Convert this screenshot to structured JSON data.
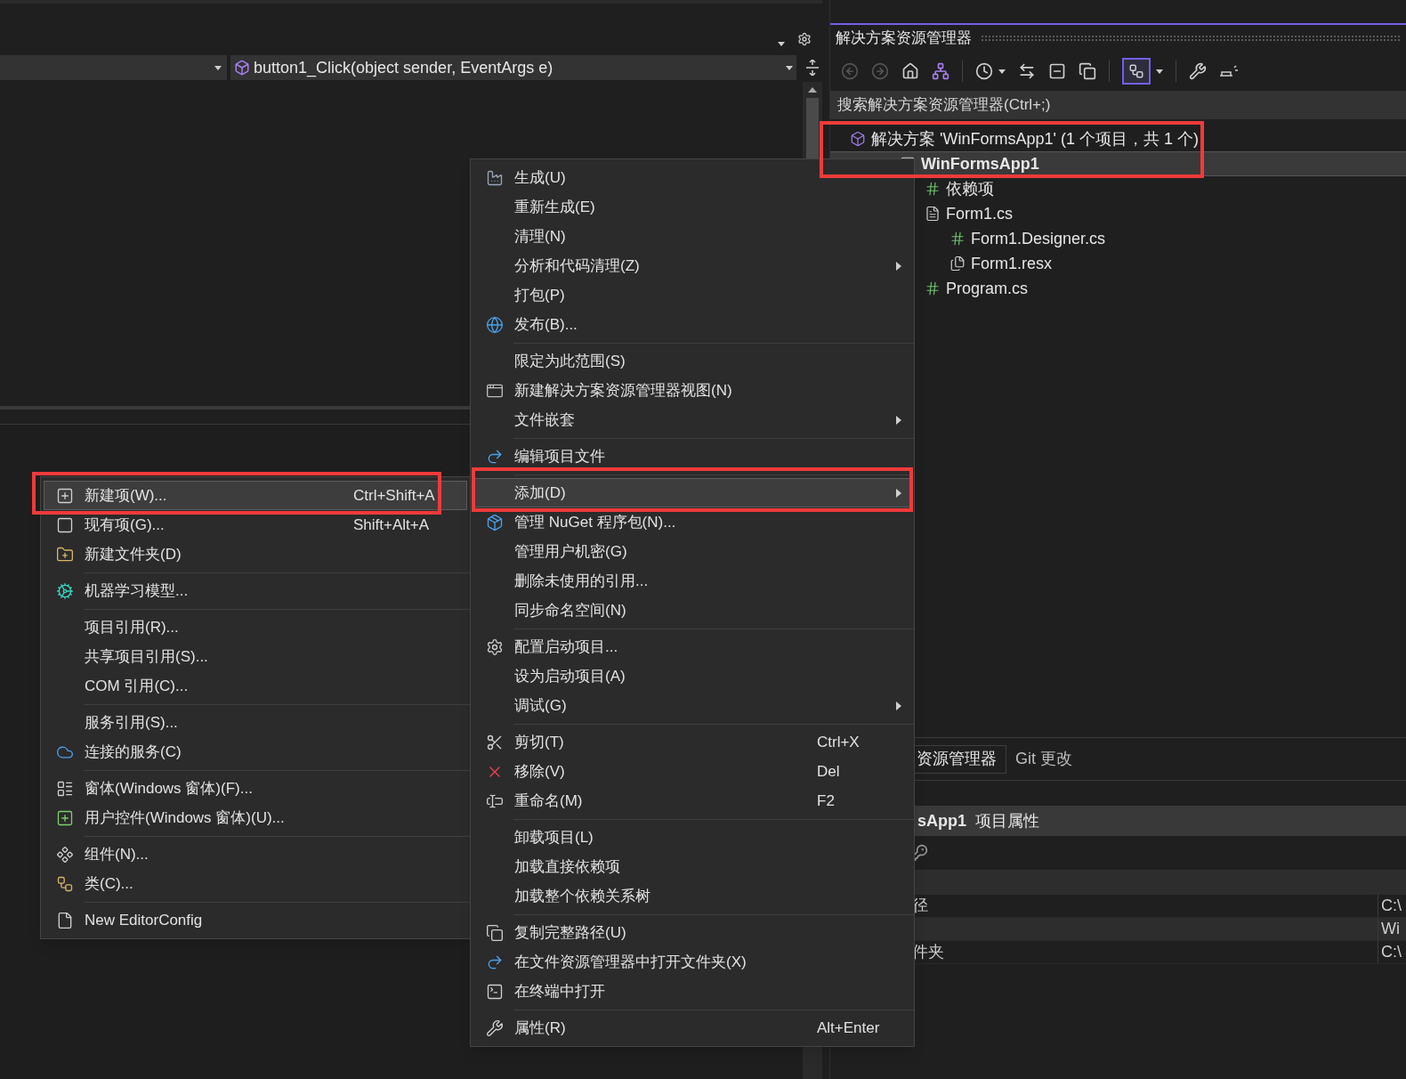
{
  "editor": {
    "member_combo": "button1_Click(object sender, EventArgs e)"
  },
  "solution_explorer": {
    "title": "解决方案资源管理器",
    "toolbar": {
      "view_toggle_on": true
    },
    "search": {
      "placeholder": "搜索解决方案资源管理器(Ctrl+;)"
    },
    "tree": [
      {
        "label": "解决方案 'WinFormsApp1' (1 个项目，共 1 个)",
        "selected": false,
        "bold": false,
        "children": [
          {
            "label": "WinFormsApp1",
            "selected": true,
            "bold": true,
            "children": [
              {
                "label": "依赖项",
                "selected": false,
                "bold": false
              },
              {
                "label": "Form1.cs",
                "selected": false,
                "bold": false,
                "children": [
                  {
                    "label": "Form1.Designer.cs",
                    "selected": false,
                    "bold": false
                  },
                  {
                    "label": "Form1.resx",
                    "selected": false,
                    "bold": false
                  }
                ]
              },
              {
                "label": "Program.cs",
                "selected": false,
                "bold": false
              }
            ]
          }
        ]
      }
    ]
  },
  "bottom_tabs": [
    {
      "label": "资源管理器",
      "selected": true
    },
    {
      "label": "Git 更改",
      "selected": false
    }
  ],
  "properties": {
    "header_name": "sApp1",
    "header_title": "项目属性",
    "rows": [
      {
        "name": "径",
        "value": "C:\\"
      },
      {
        "value": "Wi"
      },
      {
        "name": "件夹",
        "value": "C:\\"
      }
    ]
  },
  "context_menu": {
    "groups": [
      [
        {
          "label": "生成(U)",
          "kind": "command",
          "selected": false
        },
        {
          "label": "重新生成(E)",
          "kind": "command",
          "selected": false
        },
        {
          "label": "清理(N)",
          "kind": "command",
          "selected": false
        },
        {
          "label": "分析和代码清理(Z)",
          "kind": "submenu",
          "selected": false
        },
        {
          "label": "打包(P)",
          "kind": "command",
          "selected": false
        },
        {
          "label": "发布(B)...",
          "kind": "command",
          "selected": false
        }
      ],
      [
        {
          "label": "限定为此范围(S)",
          "kind": "command",
          "selected": false
        },
        {
          "label": "新建解决方案资源管理器视图(N)",
          "kind": "command",
          "selected": false
        },
        {
          "label": "文件嵌套",
          "kind": "submenu",
          "selected": false
        }
      ],
      [
        {
          "label": "编辑项目文件",
          "kind": "command",
          "selected": false
        }
      ],
      [
        {
          "label": "添加(D)",
          "kind": "submenu",
          "selected": true
        },
        {
          "label": "管理 NuGet 程序包(N)...",
          "kind": "command",
          "selected": false
        },
        {
          "label": "管理用户机密(G)",
          "kind": "command",
          "selected": false
        },
        {
          "label": "删除未使用的引用...",
          "kind": "command",
          "selected": false
        },
        {
          "label": "同步命名空间(N)",
          "kind": "command",
          "selected": false
        }
      ],
      [
        {
          "label": "配置启动项目...",
          "kind": "command",
          "selected": false
        },
        {
          "label": "设为启动项目(A)",
          "kind": "command",
          "selected": false
        },
        {
          "label": "调试(G)",
          "kind": "submenu",
          "selected": false
        }
      ],
      [
        {
          "label": "剪切(T)",
          "shortcut": "Ctrl+X",
          "kind": "command",
          "selected": false
        },
        {
          "label": "移除(V)",
          "shortcut": "Del",
          "kind": "command",
          "selected": false
        },
        {
          "label": "重命名(M)",
          "shortcut": "F2",
          "kind": "command",
          "selected": false
        }
      ],
      [
        {
          "label": "卸载项目(L)",
          "kind": "command",
          "selected": false
        },
        {
          "label": "加载直接依赖项",
          "kind": "command",
          "selected": false
        },
        {
          "label": "加载整个依赖关系树",
          "kind": "command",
          "selected": false
        }
      ],
      [
        {
          "label": "复制完整路径(U)",
          "kind": "command",
          "selected": false
        },
        {
          "label": "在文件资源管理器中打开文件夹(X)",
          "kind": "command",
          "selected": false
        },
        {
          "label": "在终端中打开",
          "kind": "command",
          "selected": false
        }
      ],
      [
        {
          "label": "属性(R)",
          "shortcut": "Alt+Enter",
          "kind": "command",
          "selected": false
        }
      ]
    ]
  },
  "add_submenu": {
    "groups": [
      [
        {
          "label": "新建项(W)...",
          "shortcut": "Ctrl+Shift+A",
          "selected": true
        },
        {
          "label": "现有项(G)...",
          "shortcut": "Shift+Alt+A",
          "selected": false
        },
        {
          "label": "新建文件夹(D)",
          "selected": false
        }
      ],
      [
        {
          "label": "机器学习模型...",
          "selected": false
        }
      ],
      [
        {
          "label": "项目引用(R)...",
          "selected": false
        },
        {
          "label": "共享项目引用(S)...",
          "selected": false
        },
        {
          "label": "COM 引用(C)...",
          "selected": false
        }
      ],
      [
        {
          "label": "服务引用(S)...",
          "selected": false
        },
        {
          "label": "连接的服务(C)",
          "selected": false
        }
      ],
      [
        {
          "label": "窗体(Windows 窗体)(F)...",
          "selected": false
        },
        {
          "label": "用户控件(Windows 窗体)(U)...",
          "selected": false
        }
      ],
      [
        {
          "label": "组件(N)...",
          "selected": false
        },
        {
          "label": "类(C)...",
          "selected": false
        }
      ],
      [
        {
          "label": "New EditorConfig",
          "selected": false
        }
      ]
    ]
  }
}
